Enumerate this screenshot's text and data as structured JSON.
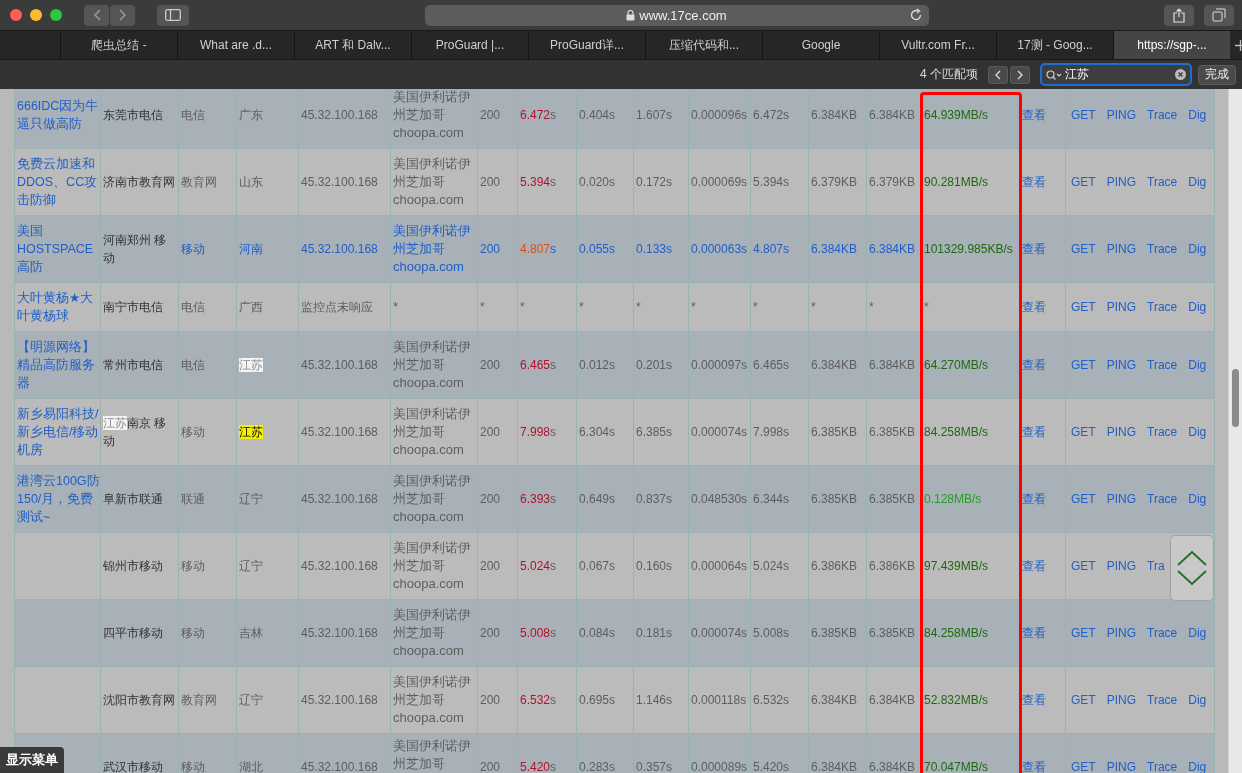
{
  "window": {
    "url": "www.17ce.com"
  },
  "tabs": [
    {
      "label": "爬虫总结 -",
      "selected": false
    },
    {
      "label": "What are .d...",
      "selected": false
    },
    {
      "label": "ART 和 Dalv...",
      "selected": false
    },
    {
      "label": "ProGuard |...",
      "selected": false
    },
    {
      "label": "ProGuard详...",
      "selected": false
    },
    {
      "label": "压缩代码和...",
      "selected": false
    },
    {
      "label": "Google",
      "selected": false
    },
    {
      "label": "Vultr.com Fr...",
      "selected": false
    },
    {
      "label": "17测 - Goog...",
      "selected": false
    },
    {
      "label": "https://sgp-...",
      "selected": true
    }
  ],
  "find_bar": {
    "match_count": "4 个匹配项",
    "query": "江苏",
    "done": "完成"
  },
  "table": {
    "rows": [
      {
        "site": "666IDC因为牛逼只做高防",
        "highlighted": false,
        "node": "东莞市电信",
        "isp": "电信",
        "province": {
          "text": "广东",
          "match": false,
          "selected": false
        },
        "ip": "45.32.100.168",
        "location": [
          "美国伊利诺伊州芝加哥",
          "choopa.com"
        ],
        "status": "200",
        "column_8": {
          "value": "6.472",
          "unit": "s",
          "color": "#b3112b"
        },
        "column_9": "0.404s",
        "column_10": "1.607s",
        "column_11": "0.000096s",
        "column_12": "6.472s",
        "column_13": "6.384KB",
        "column_14": "6.384KB",
        "column_15": {
          "text": "64.939MB/s",
          "color": "#1e6a10"
        },
        "column_16": "查看",
        "actions": [
          "GET",
          "PING",
          "Trace",
          "Dig"
        ]
      },
      {
        "site": "免费云加速和DDOS、CC攻击防御",
        "highlighted": false,
        "node": "济南市教育网",
        "isp": "教育网",
        "province": {
          "text": "山东",
          "match": false,
          "selected": false
        },
        "ip": "45.32.100.168",
        "location": [
          "美国伊利诺伊州芝加哥",
          "choopa.com"
        ],
        "status": "200",
        "column_8": {
          "value": "5.394",
          "unit": "s",
          "color": "#b3112b"
        },
        "column_9": "0.020s",
        "column_10": "0.172s",
        "column_11": "0.000069s",
        "column_12": "5.394s",
        "column_13": "6.379KB",
        "column_14": "6.379KB",
        "column_15": {
          "text": "90.281MB/s",
          "color": "#1e6a10"
        },
        "column_16": "查看",
        "actions": [
          "GET",
          "PING",
          "Trace",
          "Dig"
        ]
      },
      {
        "site": "美国HOSTSPACE高防",
        "highlighted": true,
        "node": "河南郑州 移动",
        "isp": "移动",
        "province": {
          "text": "河南",
          "match": false,
          "selected": false
        },
        "ip": "45.32.100.168",
        "location": [
          "美国伊利诺伊州芝加哥",
          "choopa.com"
        ],
        "status": "200",
        "column_8": {
          "value": "4.807",
          "unit": "s",
          "color": "#d2521c"
        },
        "column_9": "0.055s",
        "column_10": "0.133s",
        "column_11": "0.000063s",
        "column_12": "4.807s",
        "column_13": "6.384KB",
        "column_14": "6.384KB",
        "column_15": {
          "text": "101329.985KB/s",
          "color": "#1e6a10"
        },
        "column_16": "查看",
        "actions": [
          "GET",
          "PING",
          "Trace",
          "Dig"
        ]
      },
      {
        "site": "大叶黄杨★大叶黄杨球",
        "highlighted": false,
        "node": "南宁市电信",
        "isp": "电信",
        "province": {
          "text": "广西",
          "match": false,
          "selected": false
        },
        "ip": "监控点未响应",
        "location": [
          "*"
        ],
        "status": "*",
        "column_8": {
          "value": "*"
        },
        "column_9": "*",
        "column_10": "*",
        "column_11": "*",
        "column_12": "*",
        "column_13": "*",
        "column_14": "*",
        "column_15": {
          "text": "*"
        },
        "column_16": "查看",
        "actions": [
          "GET",
          "PING",
          "Trace",
          "Dig"
        ]
      },
      {
        "site": "【明源网络】精品高防服务器",
        "highlighted": false,
        "node": "常州市电信",
        "isp": "电信",
        "province": {
          "text": "江苏",
          "match": true,
          "selected": false
        },
        "ip": "45.32.100.168",
        "location": [
          "美国伊利诺伊州芝加哥",
          "choopa.com"
        ],
        "status": "200",
        "column_8": {
          "value": "6.465",
          "unit": "s",
          "color": "#b3112b"
        },
        "column_9": "0.012s",
        "column_10": "0.201s",
        "column_11": "0.000097s",
        "column_12": "6.465s",
        "column_13": "6.384KB",
        "column_14": "6.384KB",
        "column_15": {
          "text": "64.270MB/s",
          "color": "#1e6a10"
        },
        "column_16": "查看",
        "actions": [
          "GET",
          "PING",
          "Trace",
          "Dig"
        ]
      },
      {
        "site": "新乡易阳科技/新乡电信/移动机房",
        "highlighted": false,
        "node_match": "江苏",
        "node": "南京 移动",
        "isp": "移动",
        "province": {
          "text": "江苏",
          "match": true,
          "selected": true
        },
        "ip": "45.32.100.168",
        "location": [
          "美国伊利诺伊州芝加哥",
          "choopa.com"
        ],
        "status": "200",
        "column_8": {
          "value": "7.998",
          "unit": "s",
          "color": "#b3112b"
        },
        "column_9": "6.304s",
        "column_10": "6.385s",
        "column_11": "0.000074s",
        "column_12": "7.998s",
        "column_13": "6.385KB",
        "column_14": "6.385KB",
        "column_15": {
          "text": "84.258MB/s",
          "color": "#1e6a10"
        },
        "column_16": "查看",
        "actions": [
          "GET",
          "PING",
          "Trace",
          "Dig"
        ]
      },
      {
        "site": "港湾云100G防150/月，免费测试~",
        "highlighted": false,
        "node": "阜新市联通",
        "isp": "联通",
        "province": {
          "text": "辽宁",
          "match": false,
          "selected": false
        },
        "ip": "45.32.100.168",
        "location": [
          "美国伊利诺伊州芝加哥",
          "choopa.com"
        ],
        "status": "200",
        "column_8": {
          "value": "6.393",
          "unit": "s",
          "color": "#b3112b"
        },
        "column_9": "0.649s",
        "column_10": "0.837s",
        "column_11": "0.048530s",
        "column_12": "6.344s",
        "column_13": "6.385KB",
        "column_14": "6.385KB",
        "column_15": {
          "text": "0.128MB/s",
          "color": "#1fa31f"
        },
        "column_16": "查看",
        "actions": [
          "GET",
          "PING",
          "Trace",
          "Dig"
        ]
      },
      {
        "highlighted": false,
        "node": "锦州市移动",
        "isp": "移动",
        "province": {
          "text": "辽宁",
          "match": false,
          "selected": false
        },
        "ip": "45.32.100.168",
        "location": [
          "美国伊利诺伊州芝加哥",
          "choopa.com"
        ],
        "status": "200",
        "column_8": {
          "value": "5.024",
          "unit": "s",
          "color": "#b3112b"
        },
        "column_9": "0.067s",
        "column_10": "0.160s",
        "column_11": "0.000064s",
        "column_12": "5.024s",
        "column_13": "6.386KB",
        "column_14": "6.386KB",
        "column_15": {
          "text": "97.439MB/s",
          "color": "#1e6a10"
        },
        "column_16": "查看",
        "actions": [
          "GET",
          "PING",
          "Tra"
        ]
      },
      {
        "highlighted": false,
        "node": "四平市移动",
        "isp": "移动",
        "province": {
          "text": "吉林",
          "match": false,
          "selected": false
        },
        "ip": "45.32.100.168",
        "location": [
          "美国伊利诺伊州芝加哥",
          "choopa.com"
        ],
        "status": "200",
        "column_8": {
          "value": "5.008",
          "unit": "s",
          "color": "#b3112b"
        },
        "column_9": "0.084s",
        "column_10": "0.181s",
        "column_11": "0.000074s",
        "column_12": "5.008s",
        "column_13": "6.385KB",
        "column_14": "6.385KB",
        "column_15": {
          "text": "84.258MB/s",
          "color": "#1e6a10"
        },
        "column_16": "查看",
        "actions": [
          "GET",
          "PING",
          "Trace",
          "Dig"
        ]
      },
      {
        "highlighted": false,
        "node": "沈阳市教育网",
        "isp": "教育网",
        "province": {
          "text": "辽宁",
          "match": false,
          "selected": false
        },
        "ip": "45.32.100.168",
        "location": [
          "美国伊利诺伊州芝加哥",
          "choopa.com"
        ],
        "status": "200",
        "column_8": {
          "value": "6.532",
          "unit": "s",
          "color": "#b3112b"
        },
        "column_9": "0.695s",
        "column_10": "1.146s",
        "column_11": "0.000118s",
        "column_12": "6.532s",
        "column_13": "6.384KB",
        "column_14": "6.384KB",
        "column_15": {
          "text": "52.832MB/s",
          "color": "#1e6a10"
        },
        "column_16": "查看",
        "actions": [
          "GET",
          "PING",
          "Trace",
          "Dig"
        ]
      },
      {
        "highlighted": false,
        "node": "武汉市移动",
        "isp": "移动",
        "province": {
          "text": "湖北",
          "match": false,
          "selected": false
        },
        "ip": "45.32.100.168",
        "location": [
          "美国伊利诺伊州芝加哥"
        ],
        "status": "200",
        "column_8": {
          "value": "5.420",
          "unit": "s",
          "color": "#b3112b"
        },
        "column_9": "0.283s",
        "column_10": "0.357s",
        "column_11": "0.000089s",
        "column_12": "5.420s",
        "column_13": "6.384KB",
        "column_14": "6.384KB",
        "column_15": {
          "text": "70.047MB/s",
          "color": "#1e6a10"
        },
        "column_16": "查看",
        "actions": [
          "GET",
          "PING",
          "Trace",
          "Dig"
        ]
      }
    ]
  },
  "menu_toggle": "显示菜单"
}
